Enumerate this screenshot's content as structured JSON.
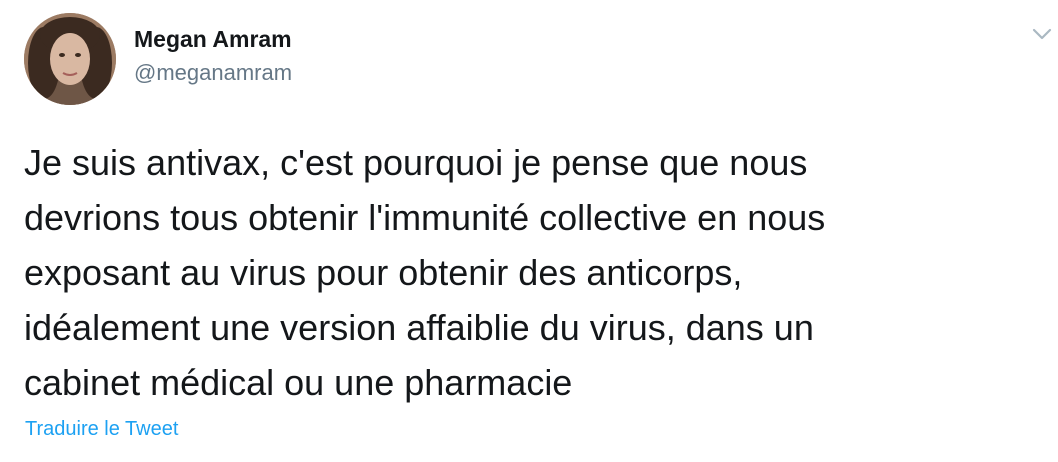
{
  "author": {
    "display_name": "Megan Amram",
    "handle": "@meganamram"
  },
  "tweet": {
    "lines": [
      "Je suis antivax, c'est pourquoi je pense que nous",
      "devrions tous obtenir l'immunité collective en nous",
      "exposant au virus pour obtenir des anticorps,",
      "idéalement une version affaiblie du virus, dans un",
      "cabinet médical ou une pharmacie"
    ]
  },
  "actions": {
    "translate_label": "Traduire le Tweet"
  },
  "icons": {
    "menu": "chevron-down-icon",
    "avatar": "avatar"
  },
  "colors": {
    "text": "#14171a",
    "secondary": "#657786",
    "link": "#1da1f2",
    "chevron": "#aab8c2"
  }
}
